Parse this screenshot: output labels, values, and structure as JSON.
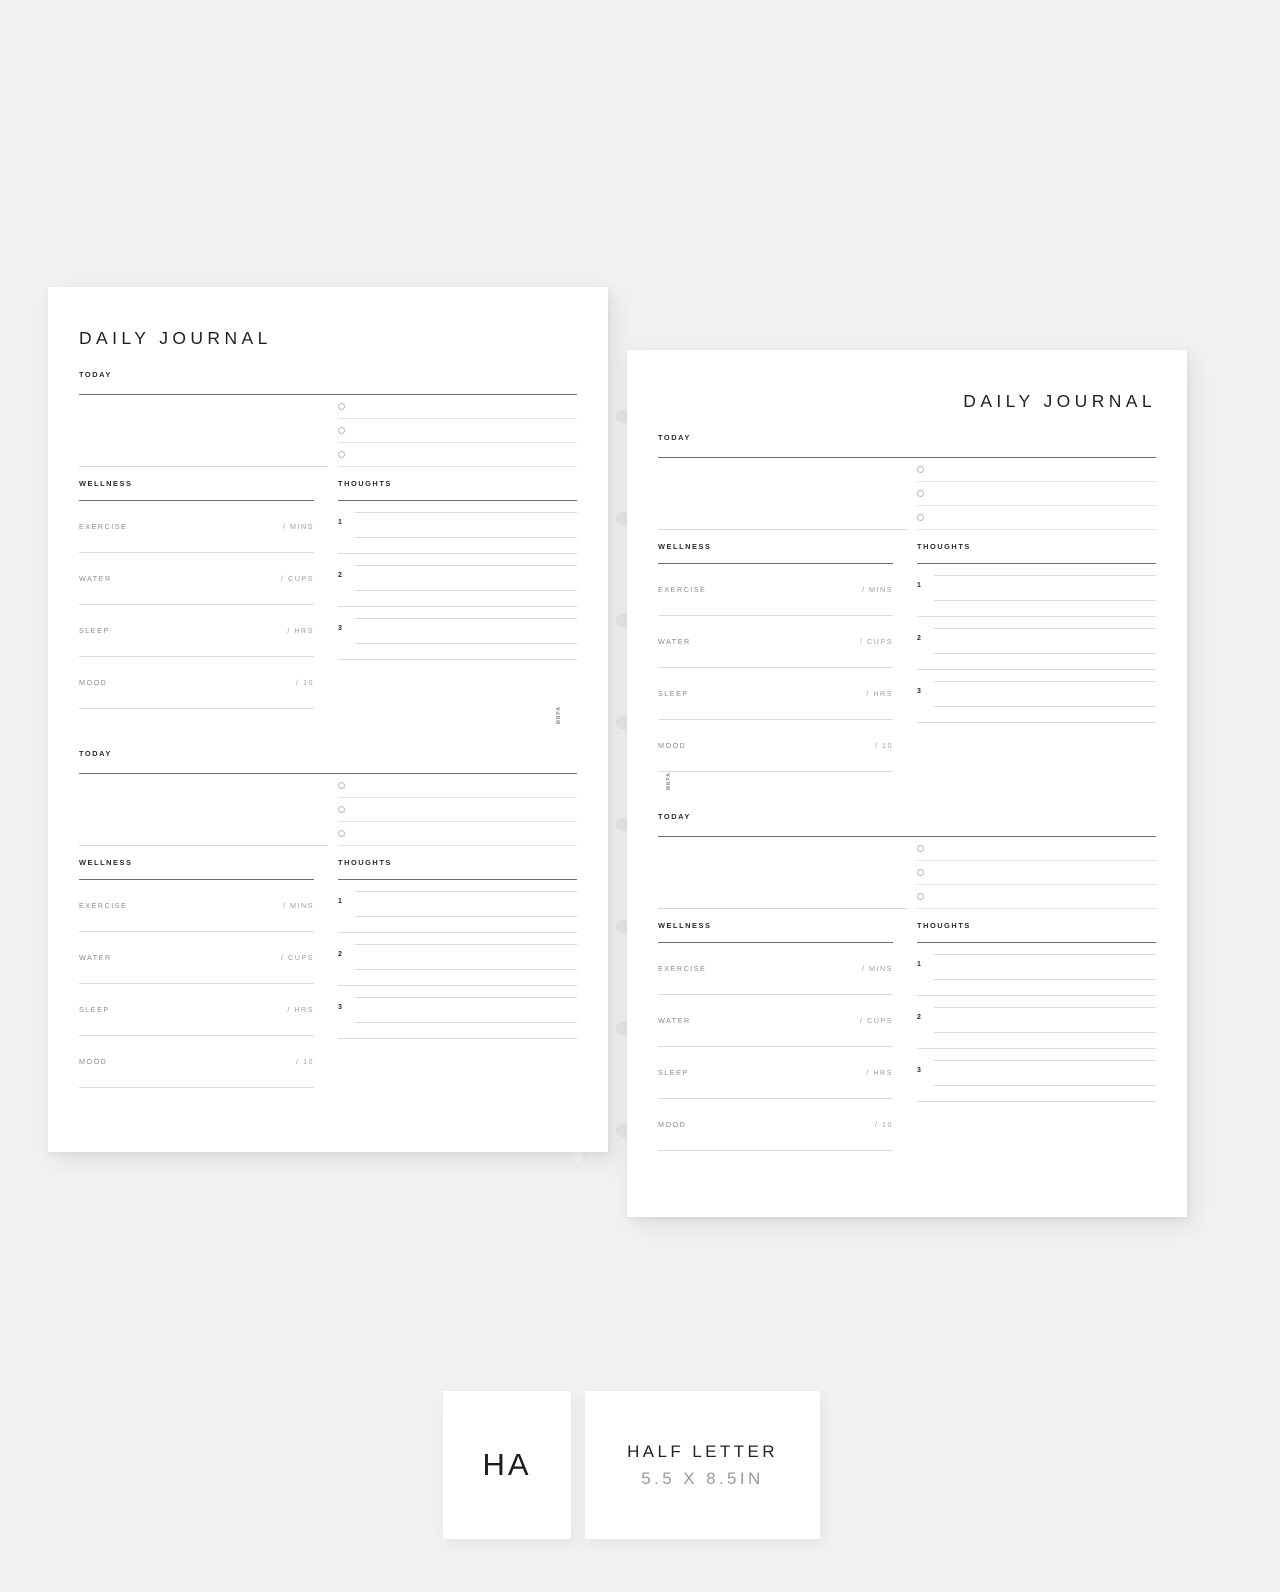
{
  "background_color": "#f2f2f1",
  "page_color": "#ffffff",
  "accent_text_color": "#221f20",
  "muted_text_color": "#8d8b8c",
  "pages": [
    {
      "id": "left-page",
      "title": "DAILY JOURNAL",
      "title_align": "left",
      "side_mark": "MNPA"
    },
    {
      "id": "right-page",
      "title": "DAILY JOURNAL",
      "title_align": "right",
      "side_mark": "MNPA"
    }
  ],
  "sections": {
    "today_label": "TODAY",
    "wellness_label": "WELLNESS",
    "thoughts_label": "THOUGHTS",
    "wellness_rows": [
      {
        "name": "EXERCISE",
        "unit": "/ MINS"
      },
      {
        "name": "WATER",
        "unit": "/ CUPS"
      },
      {
        "name": "SLEEP",
        "unit": "/ HRS"
      },
      {
        "name": "MOOD",
        "unit": "/ 10"
      }
    ],
    "thought_numbers": [
      "1",
      "2",
      "3"
    ],
    "todo_count": 3
  },
  "footer": {
    "badge_initials": "HA",
    "format_name": "HALF LETTER",
    "format_size": "5.5 X 8.5IN"
  }
}
